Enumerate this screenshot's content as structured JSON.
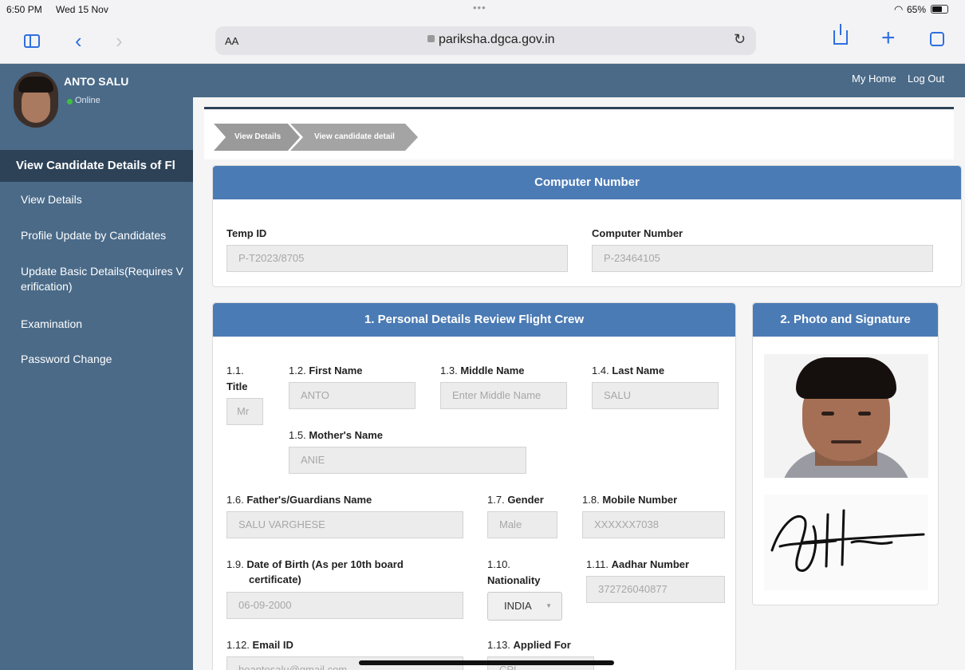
{
  "status_bar": {
    "time": "6:50 PM",
    "date": "Wed 15 Nov",
    "battery": "65%"
  },
  "browser": {
    "text_size": "AA",
    "url": "pariksha.dgca.gov.in"
  },
  "header": {
    "my_home": "My Home",
    "log_out": "Log Out"
  },
  "user": {
    "name": "ANTO SALU",
    "status": "Online"
  },
  "sidebar": {
    "heading": "View Candidate Details of Fl",
    "items": [
      {
        "label": "View Details"
      },
      {
        "label": "Profile Update by Candidates"
      },
      {
        "label": "Update Basic Details(Requires V",
        "label2": "erification)"
      },
      {
        "label": "Examination"
      },
      {
        "label": "Password Change"
      }
    ]
  },
  "breadcrumb": [
    "View Details",
    "View candidate detail"
  ],
  "computer_number_panel": {
    "title": "Computer Number",
    "temp_id_label": "Temp ID",
    "temp_id": "P-T2023/8705",
    "computer_number_label": "Computer Number",
    "computer_number": "P-23464105"
  },
  "personal": {
    "title": "1.  Personal Details Review Flight Crew",
    "title_no": "1.1.",
    "title_label": "Title",
    "title_value": "Mr",
    "first_name_no": "1.2.",
    "first_name_label": "First Name",
    "first_name": "ANTO",
    "middle_name_no": "1.3.",
    "middle_name_label": "Middle Name",
    "middle_name_placeholder": "Enter Middle Name",
    "last_name_no": "1.4.",
    "last_name_label": "Last Name",
    "last_name": "SALU",
    "mother_no": "1.5.",
    "mother_label": "Mother's Name",
    "mother": "ANIE",
    "father_no": "1.6.",
    "father_label": "Father's/Guardians Name",
    "father": "SALU VARGHESE",
    "gender_no": "1.7.",
    "gender_label": "Gender",
    "gender": "Male",
    "mobile_no": "1.8.",
    "mobile_label": "Mobile Number",
    "mobile": "XXXXXX7038",
    "dob_no": "1.9.",
    "dob_label": "Date of Birth (As per 10th board",
    "dob_label2": "certificate)",
    "dob": "06-09-2000",
    "nationality_no": "1.10.",
    "nationality_label": "Nationality",
    "nationality": "INDIA",
    "aadhar_no": "1.11.",
    "aadhar_label": "Aadhar Number",
    "aadhar": "372726040877",
    "email_no": "1.12.",
    "email_label": "Email ID",
    "email": "hoantosalu@gmail.com",
    "applied_no": "1.13.",
    "applied_label": "Applied For",
    "applied": "CPL"
  },
  "photo_panel": {
    "title": "2.  Photo and Signature"
  },
  "colors": {
    "sidebar": "#4a6a88",
    "panel_header": "#4b7bb5",
    "status_online": "#3fbf3f"
  }
}
